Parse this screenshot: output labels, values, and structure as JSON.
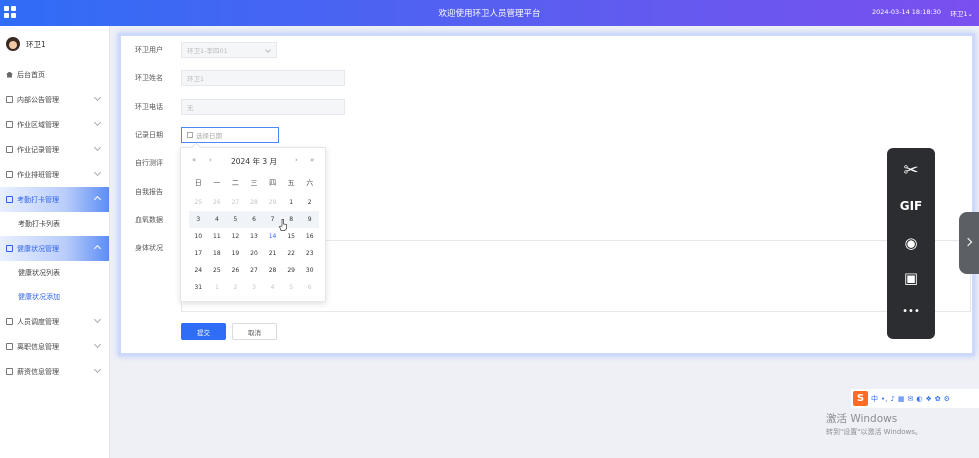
{
  "header": {
    "title": "欢迎使用环卫人员管理平台",
    "datetime": "2024-03-14 18:18:30",
    "user": "环卫1",
    "user_caret": "⌄"
  },
  "sidebar": {
    "user_name": "环卫1",
    "items": [
      {
        "label": "后台首页"
      },
      {
        "label": "内部公告管理"
      },
      {
        "label": "作业区域管理"
      },
      {
        "label": "作业记录管理"
      },
      {
        "label": "作业排班管理"
      },
      {
        "label": "考勤打卡管理"
      },
      {
        "label": "考勤打卡列表"
      },
      {
        "label": "健康状况管理"
      },
      {
        "label": "健康状况列表"
      },
      {
        "label": "健康状况添加"
      },
      {
        "label": "人员调度管理"
      },
      {
        "label": "离职信息管理"
      },
      {
        "label": "薪资信息管理"
      }
    ]
  },
  "form": {
    "labels": {
      "user": "环卫用户",
      "name": "环卫姓名",
      "phone": "环卫电话",
      "date": "记录日期",
      "item5": "自行测评",
      "item6": "自我报告",
      "item7": "血氧数据",
      "body": "身体状况"
    },
    "values": {
      "user": "环卫1-李四01",
      "name": "环卫1",
      "phone": "无"
    },
    "date_placeholder": "选择日期",
    "submit": "提交",
    "cancel": "取消"
  },
  "datepicker": {
    "nav_prev_year": "«",
    "nav_prev_month": "‹",
    "nav_next_month": "›",
    "nav_next_year": "»",
    "year_month": "2024 年 3 月",
    "weekdays": [
      "日",
      "一",
      "二",
      "三",
      "四",
      "五",
      "六"
    ],
    "days": [
      [
        "25",
        "26",
        "27",
        "28",
        "29",
        "1",
        "2"
      ],
      [
        "3",
        "4",
        "5",
        "6",
        "7",
        "8",
        "9"
      ],
      [
        "10",
        "11",
        "12",
        "13",
        "14",
        "15",
        "16"
      ],
      [
        "17",
        "18",
        "19",
        "20",
        "21",
        "22",
        "23"
      ],
      [
        "24",
        "25",
        "26",
        "27",
        "28",
        "29",
        "30"
      ],
      [
        "31",
        "1",
        "2",
        "3",
        "4",
        "5",
        "6"
      ]
    ],
    "today": "14"
  },
  "toolbar": {
    "scissors": "✂",
    "gif": "GIF",
    "record": "◉",
    "screenshot": "▣",
    "more": "•••"
  },
  "ime": {
    "logo": "S",
    "lang": "中",
    "glyphs": [
      "•,",
      "♪",
      "▦",
      "✉",
      "◐",
      "❖",
      "✿",
      "⚙"
    ]
  },
  "watermark": {
    "line1": "激活 Windows",
    "line2": "转到\"设置\"以激活 Windows。"
  }
}
